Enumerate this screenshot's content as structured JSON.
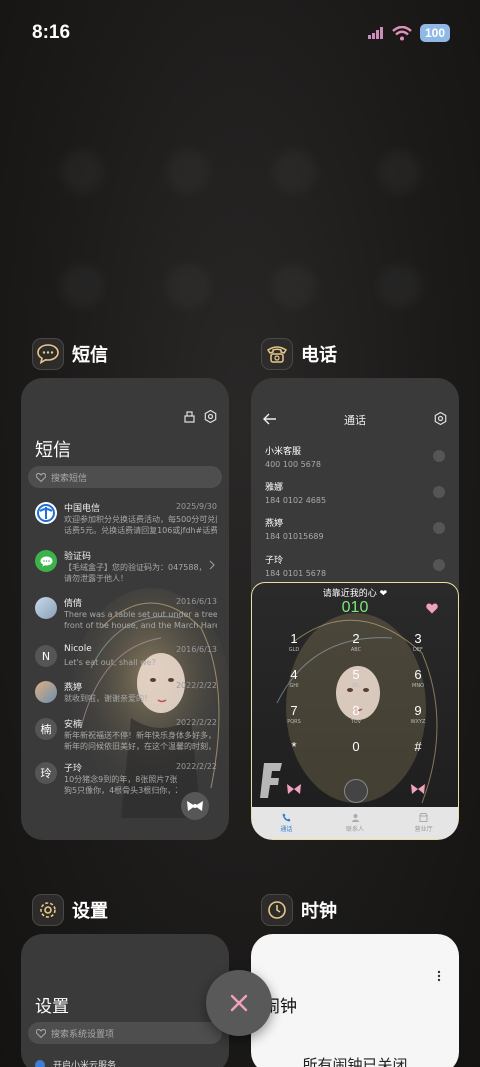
{
  "status": {
    "time": "8:16",
    "battery": "100"
  },
  "apps": {
    "sms": {
      "name": "短信",
      "title": "短信",
      "search_placeholder": "搜索短信",
      "messages": [
        {
          "name": "中国电信",
          "date": "2025/9/30",
          "text1": "欢迎参加积分兑换话费活动，每500分可兑换",
          "text2": "话费5元。兑换话费请回复106或jfdh#话费...",
          "avatar": "",
          "color": "#1e6fd8"
        },
        {
          "name": "验证码",
          "date": "",
          "text1": "【毛绒盒子】您的验证码为：047588，",
          "text2": "请勿泄露于他人！",
          "avatar": "",
          "color": "#3cb34a"
        },
        {
          "name": "倩倩",
          "date": "2016/6/13",
          "text1": "There was a table set out under a tree in",
          "text2": "front of the house, and the March Hare an...",
          "avatar": "",
          "color": "#8aa0b8"
        },
        {
          "name": "Nicole",
          "date": "2016/6/13",
          "text1": "Let's eat out, shall we?",
          "text2": "",
          "avatar": "N",
          "color": "#555"
        },
        {
          "name": "燕婷",
          "date": "2022/2/22",
          "text1": "就收到啦，谢谢亲爱的！",
          "text2": "",
          "avatar": "",
          "color": "#6a8fb0"
        },
        {
          "name": "安楠",
          "date": "2022/2/22",
          "text1": "新年新祝福送不停！新年快乐身体多好多，",
          "text2": "新年的问候依旧美好，在这个温馨的时刻，",
          "avatar": "楠",
          "color": "#555"
        },
        {
          "name": "子玲",
          "date": "2022/2/22",
          "text1": "10分猪念9到的年，8张照片7张最你，6只小",
          "text2": "狗5只像你，4根骨头3根归你，2爪着地1只...",
          "avatar": "玲",
          "color": "#555"
        }
      ]
    },
    "phone": {
      "name": "电话",
      "title": "通话",
      "contacts": [
        {
          "name": "小米客服",
          "number": "400 100 5678"
        },
        {
          "name": "雅娜",
          "number": "184 0102 4685"
        },
        {
          "name": "燕婷",
          "number": "184 01015689"
        },
        {
          "name": "子玲",
          "number": "184 0101 5678"
        }
      ],
      "dialer": {
        "header": "请靠近我的心 ❤",
        "number": "010",
        "keys": [
          {
            "d": "1",
            "l": "GLD"
          },
          {
            "d": "2",
            "l": "ABC"
          },
          {
            "d": "3",
            "l": "DEF"
          },
          {
            "d": "4",
            "l": "GHI"
          },
          {
            "d": "5",
            "l": "JKL"
          },
          {
            "d": "6",
            "l": "MNO"
          },
          {
            "d": "7",
            "l": "PQRS"
          },
          {
            "d": "8",
            "l": "TUV"
          },
          {
            "d": "9",
            "l": "WXYZ"
          },
          {
            "d": "*",
            "l": ""
          },
          {
            "d": "0",
            "l": ""
          },
          {
            "d": "#",
            "l": ""
          }
        ],
        "tabs": [
          "通话",
          "联系人",
          "营业厅"
        ]
      }
    },
    "settings": {
      "name": "设置",
      "title": "设置",
      "search_placeholder": "搜索系统设置项",
      "first_item": "开启小米云服务"
    },
    "clock": {
      "name": "时钟",
      "title": "闹钟",
      "empty_text": "所有闹钟已关闭"
    }
  },
  "colors": {
    "accent_pink": "#f0a0c0",
    "dial_green": "#7be87b"
  }
}
